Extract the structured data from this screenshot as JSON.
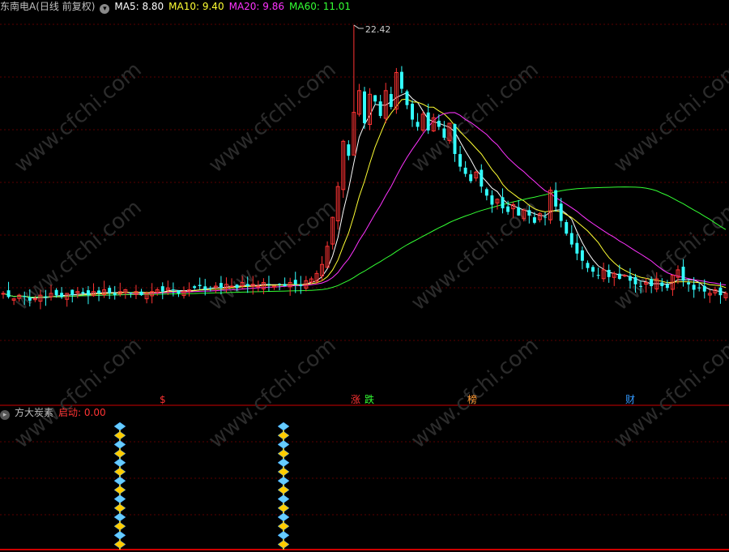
{
  "header": {
    "title": "东南电A(日线 前复权)",
    "menu_icon": "chevron-down-icon",
    "ma5": "MA5: 8.80",
    "ma10": "MA10: 9.40",
    "ma20": "MA20: 9.86",
    "ma60": "MA60: 11.01",
    "colors": {
      "ma5": "#ffffff",
      "ma10": "#ffff33",
      "ma20": "#ff33ff",
      "ma60": "#33ff33",
      "title": "#c0c0c0"
    }
  },
  "price_high_label": "22.42",
  "event_markers": [
    {
      "text": "$",
      "color": "#ff3333"
    },
    {
      "text": "涨",
      "color": "#ff3333"
    },
    {
      "text": "跌",
      "color": "#33ff33"
    },
    {
      "text": "榜",
      "color": "#ff9933"
    },
    {
      "text": "财",
      "color": "#3399ff"
    }
  ],
  "indicator": {
    "name": "方大炭素",
    "signal_label": "启动: 0.00",
    "signal_color": "#ff3333",
    "name_color": "#c0c0c0"
  },
  "watermark": "www.cfchi.com",
  "colors": {
    "up": "#ff3333",
    "down": "#33ffff",
    "grid": "#550000",
    "axis": "#cc0000",
    "background": "#000000"
  },
  "chart_data": {
    "type": "candlestick",
    "price_range": [
      5.0,
      23.0
    ],
    "high_marker": 22.42,
    "closes": [
      7.6,
      7.4,
      7.3,
      7.5,
      7.4,
      7.2,
      7.3,
      7.5,
      7.4,
      7.6,
      7.5,
      7.4,
      7.6,
      7.5,
      7.7,
      7.6,
      7.5,
      7.7,
      7.6,
      7.8,
      7.6,
      7.5,
      7.7,
      7.8,
      7.6,
      7.7,
      7.5,
      7.6,
      7.7,
      7.8,
      7.7,
      7.9,
      7.8,
      7.6,
      7.7,
      7.8,
      7.9,
      8.0,
      7.8,
      7.9,
      8.0,
      7.9,
      8.1,
      8.0,
      7.9,
      8.2,
      8.0,
      8.1,
      8.0,
      8.2,
      8.1,
      8.0,
      8.1,
      8.0,
      8.2,
      8.1,
      8.0,
      8.3,
      8.4,
      8.7,
      9.2,
      10.2,
      11.8,
      13.5,
      16.0,
      15.2,
      17.6,
      18.8,
      17.0,
      18.6,
      18.2,
      17.4,
      18.8,
      17.9,
      19.8,
      18.9,
      18.0,
      17.2,
      16.8,
      17.5,
      16.6,
      17.3,
      16.8,
      16.2,
      17.0,
      15.3,
      14.6,
      14.2,
      13.8,
      14.3,
      13.5,
      13.0,
      12.5,
      12.8,
      12.3,
      12.1,
      12.5,
      11.9,
      12.2,
      11.9,
      11.5,
      12.0,
      11.8,
      13.3,
      12.4,
      11.6,
      10.9,
      10.3,
      9.8,
      9.4,
      9.0,
      8.8,
      8.6,
      8.9,
      8.5,
      8.7,
      8.4,
      8.6,
      8.3,
      8.1,
      8.0,
      8.2,
      8.0,
      8.4,
      8.0,
      7.9,
      8.6,
      8.9,
      8.3,
      8.1,
      7.8,
      7.9,
      7.7,
      7.6,
      7.8,
      7.5,
      7.6
    ],
    "ma_series": [
      {
        "name": "MA5"
      },
      {
        "name": "MA10"
      },
      {
        "name": "MA20"
      },
      {
        "name": "MA60"
      }
    ],
    "indicator_signals": [
      "启动",
      "启动"
    ]
  }
}
